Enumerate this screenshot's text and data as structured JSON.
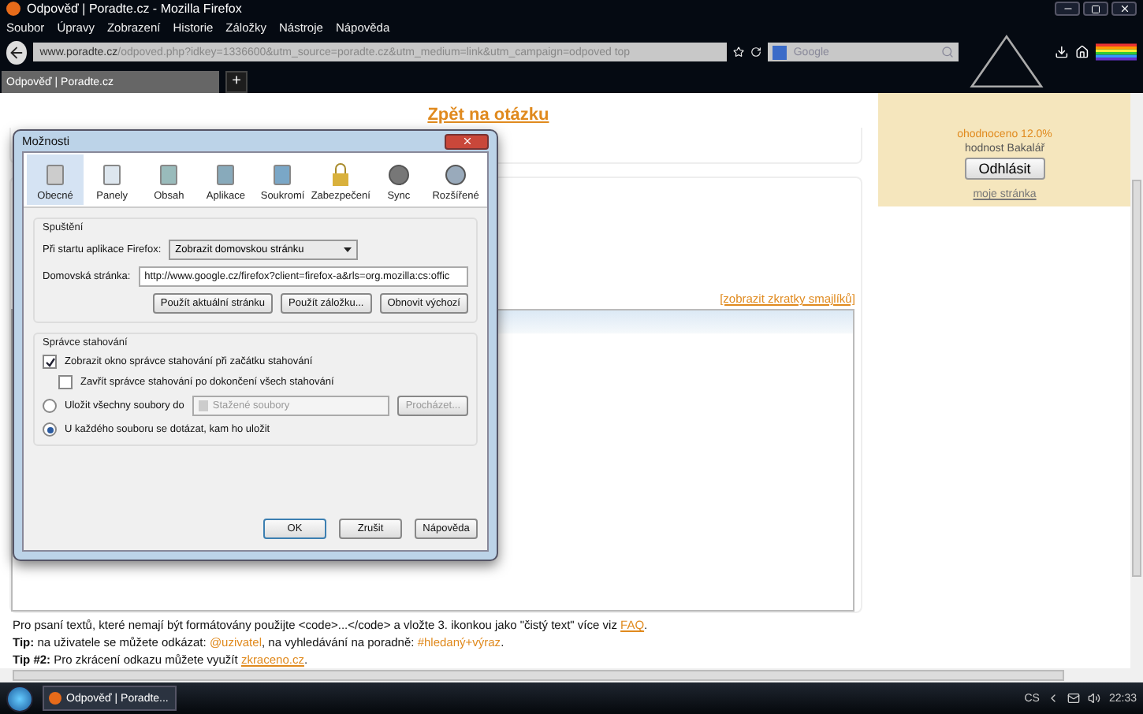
{
  "window": {
    "title": "Odpověď | Poradte.cz - Mozilla Firefox"
  },
  "menu": [
    "Soubor",
    "Úpravy",
    "Zobrazení",
    "Historie",
    "Záložky",
    "Nástroje",
    "Nápověda"
  ],
  "address": {
    "domain": "www.poradte.cz",
    "path": "/odpoved.php?idkey=1336600&utm_source=poradte.cz&utm_medium=link&utm_campaign=odpoved top"
  },
  "search": {
    "placeholder": "Google"
  },
  "tabs": [
    {
      "label": "Odpověď | Poradte.cz",
      "selected": true
    }
  ],
  "new_tab": "+",
  "page": {
    "back_link": "Zpět na otázku",
    "smiley_link": "[zobrazit zkratky smajlíků]",
    "help_lines": [
      [
        {
          "kind": "plain",
          "text": "Pro psaní textů, které nemají být formátovány použijte <code>...</code> a vložte 3. ikonkou jako \"čistý text\" více viz "
        },
        {
          "kind": "link",
          "text": "FAQ"
        },
        {
          "kind": "plain",
          "text": "."
        }
      ],
      [
        {
          "kind": "bold",
          "text": "Tip:"
        },
        {
          "kind": "plain",
          "text": " na uživatele se můžete odkázat: "
        },
        {
          "kind": "tag",
          "text": "@uzivatel"
        },
        {
          "kind": "plain",
          "text": ", na vyhledávání na poradně: "
        },
        {
          "kind": "tag",
          "text": "#hledaný+výraz"
        },
        {
          "kind": "plain",
          "text": "."
        }
      ],
      [
        {
          "kind": "bold",
          "text": "Tip #2:"
        },
        {
          "kind": "plain",
          "text": " Pro zkrácení odkazu můžete využít "
        },
        {
          "kind": "link",
          "text": "zkraceno.cz"
        },
        {
          "kind": "plain",
          "text": "."
        }
      ]
    ]
  },
  "sidebar": {
    "rating": "ohodnoceno 12.0%",
    "rank": "hodnost Bakalář",
    "logout": "Odhlásit",
    "profile_link": "moje stránka"
  },
  "dialog": {
    "title": "Možnosti",
    "panes": [
      {
        "label": "Obecné",
        "selected": true
      },
      {
        "label": "Panely",
        "selected": false
      },
      {
        "label": "Obsah",
        "selected": false
      },
      {
        "label": "Aplikace",
        "selected": false
      },
      {
        "label": "Soukromí",
        "selected": false
      },
      {
        "label": "Zabezpečení",
        "selected": false
      },
      {
        "label": "Sync",
        "selected": false
      },
      {
        "label": "Rozšířené",
        "selected": false
      }
    ],
    "startup": {
      "heading": "Spuštění",
      "start_label": "Při startu aplikace Firefox:",
      "start_value": "Zobrazit domovskou stránku",
      "home_label": "Domovská stránka:",
      "home_value": "http://www.google.cz/firefox?client=firefox-a&rls=org.mozilla:cs:offic",
      "buttons": [
        "Použít aktuální stránku",
        "Použít záložku...",
        "Obnovit výchozí"
      ]
    },
    "downloads": {
      "heading": "Správce stahování",
      "checks": [
        {
          "label": "Zobrazit okno správce stahování při začátku stahování",
          "checked": true,
          "children": [
            {
              "label": "Zavřít správce stahování po dokončení všech stahování",
              "checked": false
            }
          ]
        }
      ],
      "radios": [
        {
          "label": "Uložit všechny soubory do",
          "selected": false,
          "folder": "Stažené soubory",
          "browse": "Procházet...",
          "disabled": true
        },
        {
          "label": "U každého souboru se dotázat, kam ho uložit",
          "selected": true
        }
      ]
    },
    "buttons": [
      "OK",
      "Zrušit",
      "Nápověda"
    ]
  },
  "taskbar": {
    "task": "Odpověď | Poradte...",
    "language": "CS",
    "time": "22:33"
  }
}
